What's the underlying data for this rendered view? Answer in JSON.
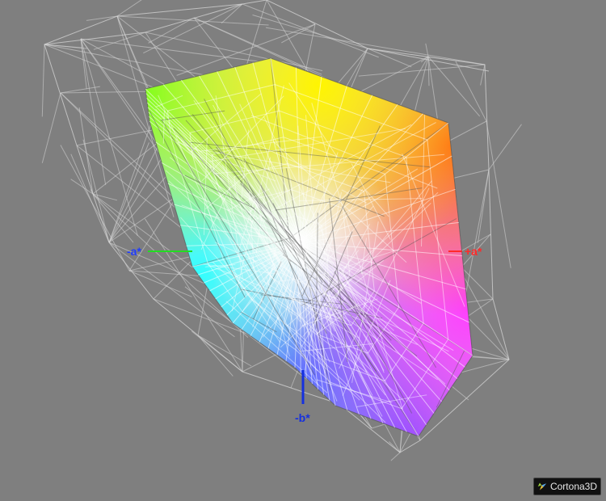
{
  "viewer": {
    "brand": "Cortona3D",
    "background": "#7f7f7f",
    "icon": "cortona-logo-icon"
  },
  "axes": {
    "neg_a": {
      "label": "-a*",
      "color": "#1f3cff",
      "line_color": "#22dd22"
    },
    "pos_a": {
      "label": "+a*",
      "color": "#ff2a2a",
      "line_color": "#ff2a2a"
    },
    "neg_b": {
      "label": "-b*",
      "color": "#1530e0",
      "line_color": "#1530e0"
    }
  },
  "colors": {
    "wireframe": "#d6d6d6",
    "mesh_dark": "#555555",
    "yellow": "#fff500",
    "green": "#7cff20",
    "orange": "#ff7a1a",
    "red": "#ff3b3b",
    "magenta": "#ff3cff",
    "violet": "#9a55ff",
    "blue": "#4c6dff",
    "cyan": "#30ffff",
    "white": "#ffffff"
  }
}
